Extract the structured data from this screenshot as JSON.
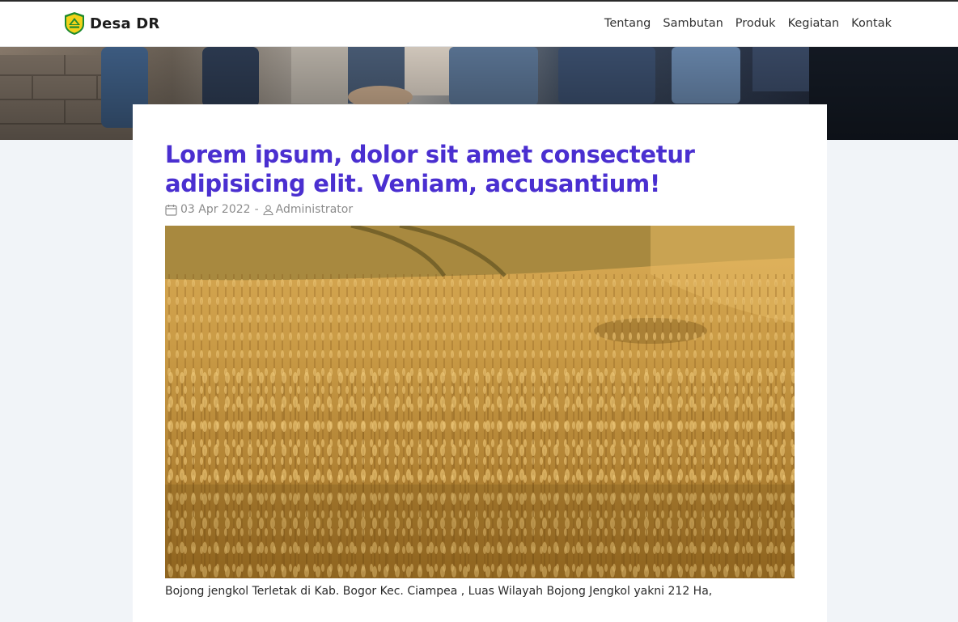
{
  "navbar": {
    "brand": "Desa DR",
    "logo_icon": "village-emblem-icon",
    "menu": [
      {
        "label": "Tentang"
      },
      {
        "label": "Sambutan"
      },
      {
        "label": "Produk"
      },
      {
        "label": "Kegiatan"
      },
      {
        "label": "Kontak"
      }
    ]
  },
  "article": {
    "title": "Lorem ipsum, dolor sit amet consectetur adipisicing elit. Veniam, accusantium!",
    "date": "03 Apr 2022",
    "separator": "-",
    "author": "Administrator",
    "date_icon": "calendar-icon",
    "author_icon": "user-icon",
    "image_icon": "wheat-field-photo",
    "body_first_line": "Bojong jengkol Terletak di Kab. Bogor Kec. Ciampea , Luas Wilayah Bojong Jengkol yakni 212 Ha,"
  },
  "colors": {
    "title": "#4a2fd0",
    "meta": "#8c8c8c",
    "page_bg": "#f1f4f8",
    "logo_shield": "#1e8a2e",
    "logo_fill": "#f2d21a"
  }
}
